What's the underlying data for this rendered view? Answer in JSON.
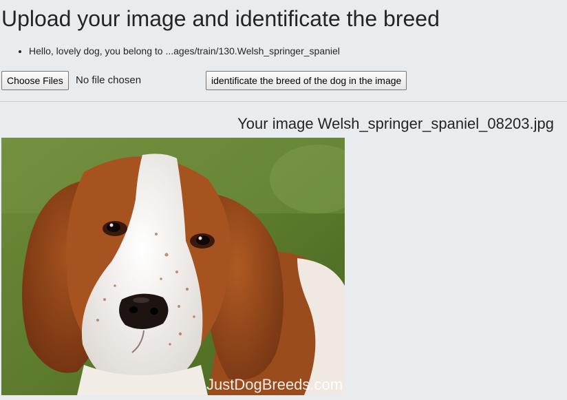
{
  "page": {
    "title": "Upload your image and identificate the breed"
  },
  "result": {
    "message": "Hello, lovely dog, you belong to ...ages/train/130.Welsh_springer_spaniel"
  },
  "upload": {
    "choose_files_label": "Choose Files",
    "file_status": "No file chosen",
    "submit_label": "identificate the breed of the dog in the image"
  },
  "preview": {
    "caption": "Your image Welsh_springer_spaniel_08203.jpg",
    "watermark": "JustDogBreeds.com",
    "subject": "welsh-springer-spaniel-photo"
  }
}
